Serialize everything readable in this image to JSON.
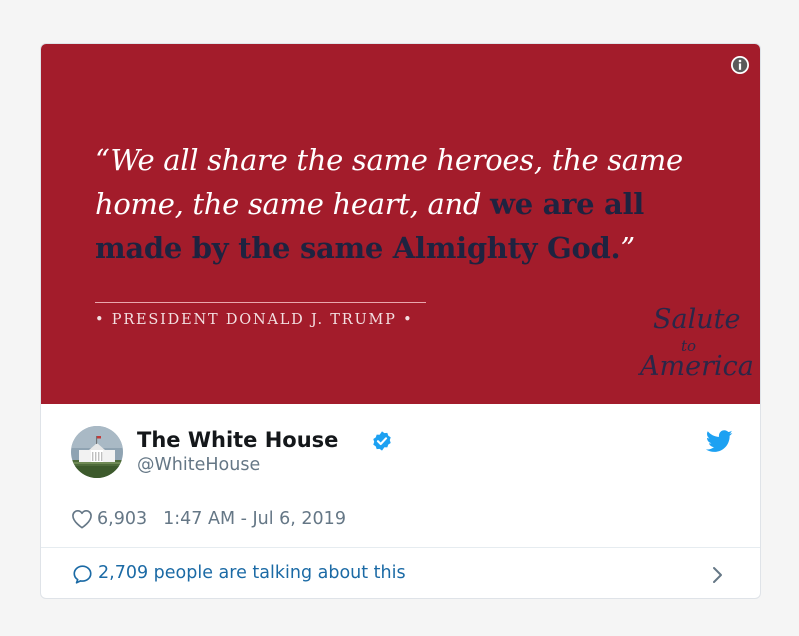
{
  "media": {
    "quote_part1": "“We all share the same heroes, the same home, the same heart, and ",
    "quote_part2": "we are all made by the same Almighty God.",
    "quote_close": "”",
    "attribution": "• PRESIDENT DONALD J. TRUMP •",
    "logo": {
      "line1": "Salute",
      "line2": "to",
      "line3": "America"
    },
    "info_icon": "info-icon",
    "background_color": "#a31c2b",
    "emphasis_color": "#1e2340"
  },
  "author": {
    "display_name": "The White House",
    "handle": "@WhiteHouse",
    "verified": true,
    "avatar_icon": "white-house-avatar",
    "brand_icon": "twitter-bird-icon",
    "brand_color": "#1da1f2"
  },
  "meta": {
    "like_icon": "heart-icon",
    "likes": "6,903",
    "timestamp": "1:47 AM - Jul 6, 2019"
  },
  "footer": {
    "icon": "speech-bubble-icon",
    "text": "2,709 people are talking about this",
    "chevron": "chevron-right-icon",
    "link_color": "#1b6aa5"
  }
}
